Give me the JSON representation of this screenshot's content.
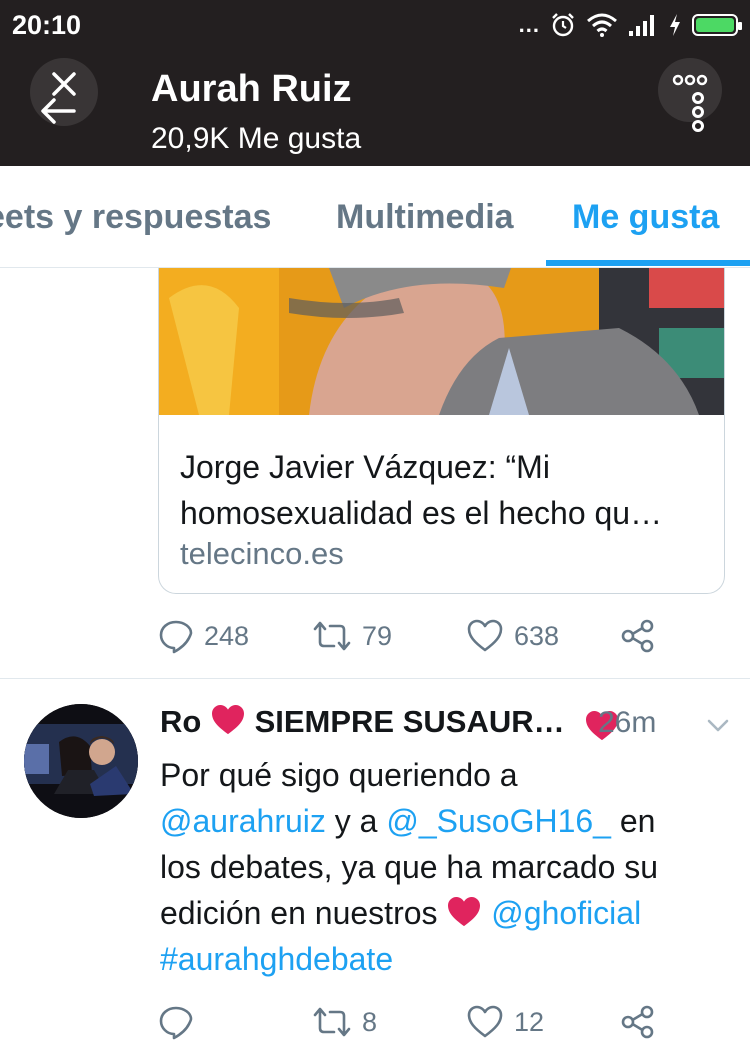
{
  "status_bar": {
    "time": "20:10",
    "more": "...",
    "icons": [
      "more-dots-icon",
      "alarm-icon",
      "wifi-icon",
      "signal-icon",
      "charging-icon",
      "battery-icon"
    ]
  },
  "header": {
    "title": "Aurah Ruiz",
    "subtitle": "20,9K Me gusta",
    "background": "#231f20"
  },
  "tabs": [
    {
      "label": "Tweets y respuestas",
      "visible_label": "eets y respuestas",
      "selected": false
    },
    {
      "label": "Multimedia",
      "selected": false
    },
    {
      "label": "Me gusta",
      "selected": true
    }
  ],
  "colors": {
    "accent": "#1da1f2",
    "muted": "#657786",
    "heart": "#e0245e"
  },
  "feed": {
    "first_tweet": {
      "card": {
        "title": "Jorge Javier Vázquez: “Mi homosexualidad es el hecho qu…",
        "domain": "telecinco.es"
      },
      "actions": {
        "replies": "248",
        "retweets": "79",
        "likes": "638"
      }
    },
    "second_tweet": {
      "author": "Ro",
      "author_rest": "SIEMPRE SUSAUR…",
      "time": "26m",
      "text": {
        "l1": "Por qué sigo queriendo a",
        "mention1": "@aurahruiz",
        "mid": " y a ",
        "mention2": "@_SusoGH16_",
        "en": " en",
        "l3": "los debates, ya que ha marcado su",
        "l4": "edición en nuestros ",
        "mention3": "@ghoficial",
        "hashtag": "#aurahghdebate"
      },
      "actions": {
        "replies": "",
        "retweets": "8",
        "likes": "12"
      }
    }
  }
}
